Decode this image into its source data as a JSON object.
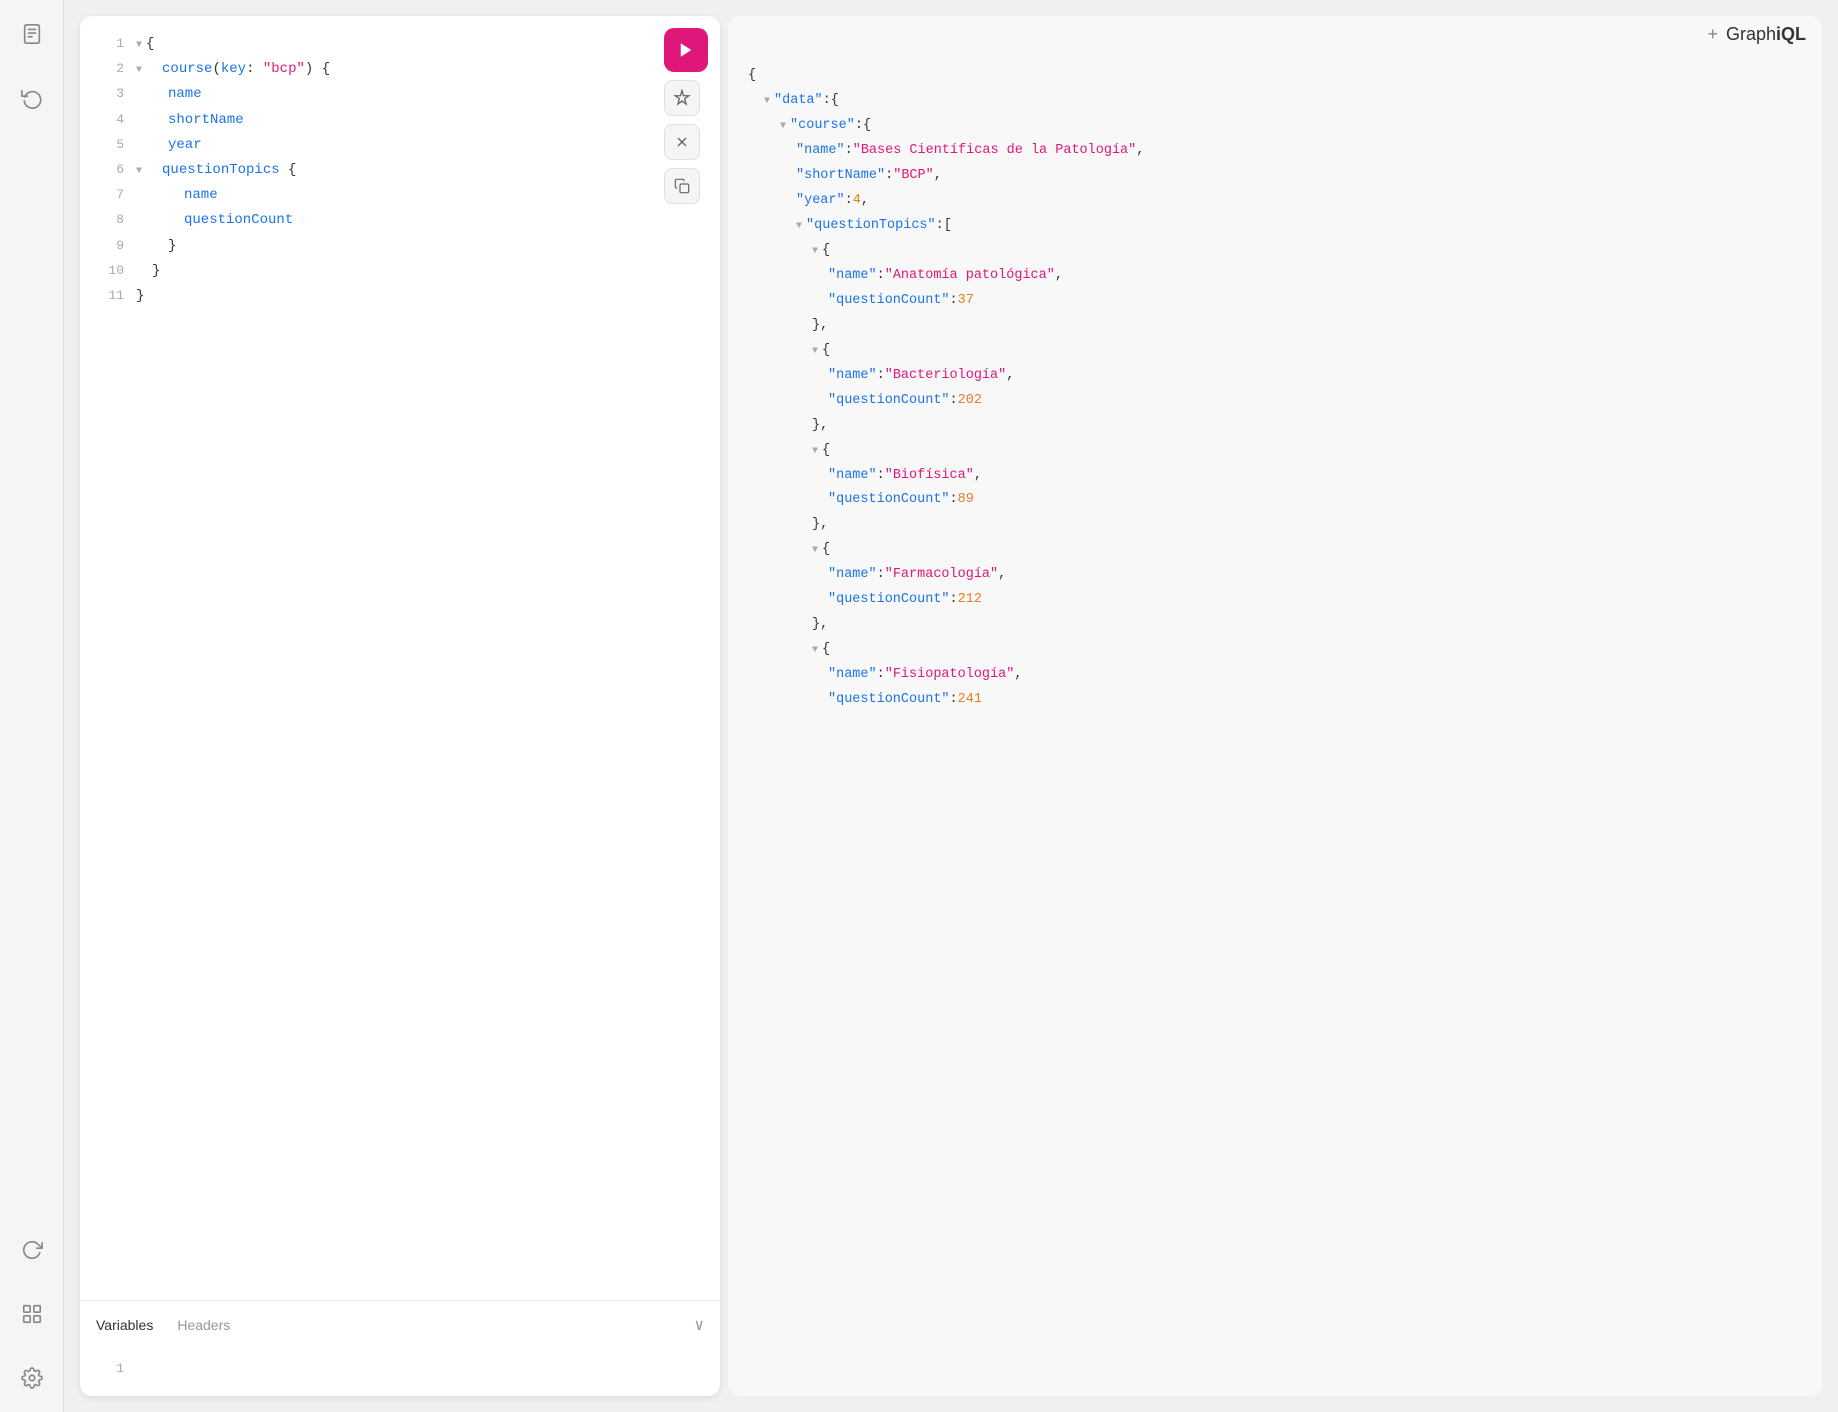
{
  "app": {
    "title": "Graph",
    "title_bold": "iQL",
    "plus_icon": "+"
  },
  "sidebar": {
    "icons": [
      {
        "name": "document-icon",
        "symbol": "☰"
      },
      {
        "name": "history-icon",
        "symbol": "↺"
      },
      {
        "name": "refresh-icon",
        "symbol": "⟳"
      },
      {
        "name": "shortcut-icon",
        "symbol": "⌘"
      },
      {
        "name": "settings-icon",
        "symbol": "⚙"
      }
    ]
  },
  "toolbar": {
    "run_label": "▶",
    "magic_label": "✦",
    "close_label": "✕",
    "copy_label": "⧉"
  },
  "editor": {
    "lines": [
      {
        "num": "1",
        "indent": 0,
        "has_arrow": true,
        "content": "{"
      },
      {
        "num": "2",
        "indent": 1,
        "has_arrow": true,
        "content": "course(key: \"bcp\") {"
      },
      {
        "num": "3",
        "indent": 2,
        "has_arrow": false,
        "content": "name"
      },
      {
        "num": "4",
        "indent": 2,
        "has_arrow": false,
        "content": "shortName"
      },
      {
        "num": "5",
        "indent": 2,
        "has_arrow": false,
        "content": "year"
      },
      {
        "num": "6",
        "indent": 2,
        "has_arrow": true,
        "content": "questionTopics {"
      },
      {
        "num": "7",
        "indent": 3,
        "has_arrow": false,
        "content": "name"
      },
      {
        "num": "8",
        "indent": 3,
        "has_arrow": false,
        "content": "questionCount"
      },
      {
        "num": "9",
        "indent": 2,
        "has_arrow": false,
        "content": "}"
      },
      {
        "num": "10",
        "indent": 1,
        "has_arrow": false,
        "content": "}"
      },
      {
        "num": "11",
        "indent": 0,
        "has_arrow": false,
        "content": "}"
      }
    ]
  },
  "variables": {
    "tab1": "Variables",
    "tab2": "Headers",
    "chevron": "∨",
    "line1_num": "1"
  },
  "result": {
    "lines": [
      {
        "indent": 0,
        "has_arrow": false,
        "content": "{"
      },
      {
        "indent": 1,
        "has_arrow": true,
        "key": "\"data\"",
        "colon": ": ",
        "value": "{"
      },
      {
        "indent": 2,
        "has_arrow": true,
        "key": "\"course\"",
        "colon": ": ",
        "value": "{"
      },
      {
        "indent": 3,
        "has_arrow": false,
        "key": "\"name\"",
        "colon": ": ",
        "value": "\"Bases Científicas de la Patología\",",
        "type": "str"
      },
      {
        "indent": 3,
        "has_arrow": false,
        "key": "\"shortName\"",
        "colon": ": ",
        "value": "\"BCP\",",
        "type": "str"
      },
      {
        "indent": 3,
        "has_arrow": false,
        "key": "\"year\"",
        "colon": ": ",
        "value": "4,",
        "type": "num"
      },
      {
        "indent": 3,
        "has_arrow": true,
        "key": "\"questionTopics\"",
        "colon": ": ",
        "value": "["
      },
      {
        "indent": 4,
        "has_arrow": true,
        "brace_only": "{"
      },
      {
        "indent": 5,
        "has_arrow": false,
        "key": "\"name\"",
        "colon": ": ",
        "value": "\"Anatomía patológica\",",
        "type": "str"
      },
      {
        "indent": 5,
        "has_arrow": false,
        "key": "\"questionCount\"",
        "colon": ": ",
        "value": "37",
        "type": "num"
      },
      {
        "indent": 4,
        "has_arrow": false,
        "brace_only": "},"
      },
      {
        "indent": 4,
        "has_arrow": true,
        "brace_only": "{"
      },
      {
        "indent": 5,
        "has_arrow": false,
        "key": "\"name\"",
        "colon": ": ",
        "value": "\"Bacteriología\",",
        "type": "str"
      },
      {
        "indent": 5,
        "has_arrow": false,
        "key": "\"questionCount\"",
        "colon": ": ",
        "value": "202",
        "type": "num"
      },
      {
        "indent": 4,
        "has_arrow": false,
        "brace_only": "},"
      },
      {
        "indent": 4,
        "has_arrow": true,
        "brace_only": "{"
      },
      {
        "indent": 5,
        "has_arrow": false,
        "key": "\"name\"",
        "colon": ": ",
        "value": "\"Biofísica\",",
        "type": "str"
      },
      {
        "indent": 5,
        "has_arrow": false,
        "key": "\"questionCount\"",
        "colon": ": ",
        "value": "89",
        "type": "num"
      },
      {
        "indent": 4,
        "has_arrow": false,
        "brace_only": "},"
      },
      {
        "indent": 4,
        "has_arrow": true,
        "brace_only": "{"
      },
      {
        "indent": 5,
        "has_arrow": false,
        "key": "\"name\"",
        "colon": ": ",
        "value": "\"Farmacología\",",
        "type": "str"
      },
      {
        "indent": 5,
        "has_arrow": false,
        "key": "\"questionCount\"",
        "colon": ": ",
        "value": "212",
        "type": "num"
      },
      {
        "indent": 4,
        "has_arrow": false,
        "brace_only": "},"
      },
      {
        "indent": 4,
        "has_arrow": true,
        "brace_only": "{"
      },
      {
        "indent": 5,
        "has_arrow": false,
        "key": "\"name\"",
        "colon": ": ",
        "value": "\"Fisiopatología\",",
        "type": "str"
      },
      {
        "indent": 5,
        "has_arrow": false,
        "key": "\"questionCount\"",
        "colon": ": ",
        "value": "241",
        "type": "num"
      },
      {
        "indent": 4,
        "has_arrow": false,
        "brace_only": "}"
      }
    ]
  }
}
